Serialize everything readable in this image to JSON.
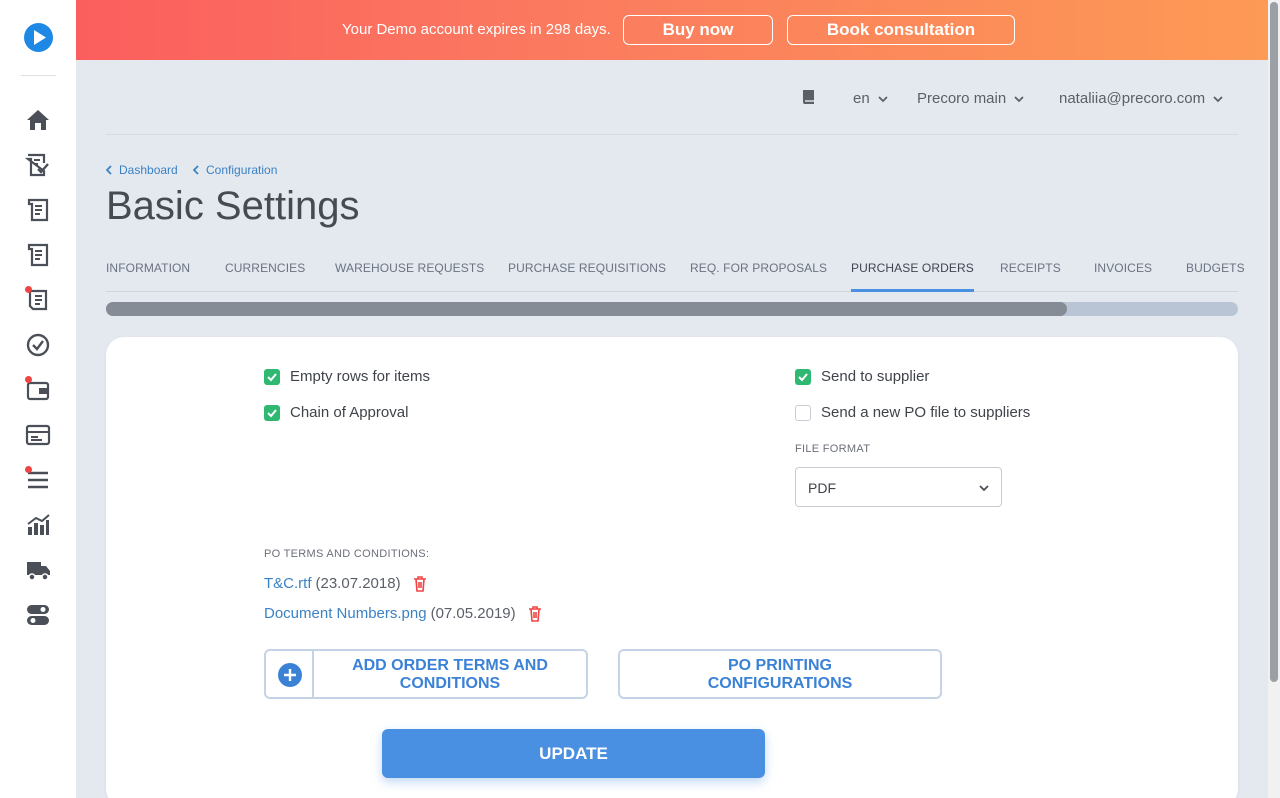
{
  "banner": {
    "message": "Your Demo account expires in 298 days.",
    "buy_label": "Buy now",
    "book_label": "Book consultation"
  },
  "header": {
    "language": "en",
    "company": "Precoro main",
    "user": "nataliia@precoro.com"
  },
  "breadcrumb": [
    "Dashboard",
    "Configuration"
  ],
  "page_title": "Basic Settings",
  "tabs": [
    {
      "label": "INFORMATION"
    },
    {
      "label": "CURRENCIES"
    },
    {
      "label": "WAREHOUSE REQUESTS"
    },
    {
      "label": "PURCHASE REQUISITIONS"
    },
    {
      "label": "REQ. FOR PROPOSALS"
    },
    {
      "label": "PURCHASE ORDERS",
      "active": true
    },
    {
      "label": "RECEIPTS"
    },
    {
      "label": "INVOICES"
    },
    {
      "label": "BUDGETS"
    }
  ],
  "settings": {
    "empty_rows": {
      "label": "Empty rows for items",
      "checked": true
    },
    "chain_approval": {
      "label": "Chain of Approval",
      "checked": true
    },
    "send_supplier": {
      "label": "Send to supplier",
      "checked": true
    },
    "send_new_po": {
      "label": "Send a new PO file to suppliers",
      "checked": false
    },
    "file_format_label": "FILE FORMAT",
    "file_format_value": "PDF"
  },
  "terms": {
    "label": "PO TERMS AND CONDITIONS:",
    "files": [
      {
        "name": "T&C.rtf",
        "date": "(23.07.2018)"
      },
      {
        "name": "Document Numbers.png",
        "date": "(07.05.2019)"
      }
    ]
  },
  "buttons": {
    "add_terms_line1": "ADD ORDER TERMS AND",
    "add_terms_line2": "CONDITIONS",
    "po_printing_line1": "PO PRINTING",
    "po_printing_line2": "CONFIGURATIONS",
    "update": "UPDATE"
  },
  "colors": {
    "accent": "#4a90e2",
    "check_green": "#2eb872",
    "banner_start": "#fb5e5e",
    "banner_end": "#fd9a55",
    "danger": "#ef4444"
  }
}
